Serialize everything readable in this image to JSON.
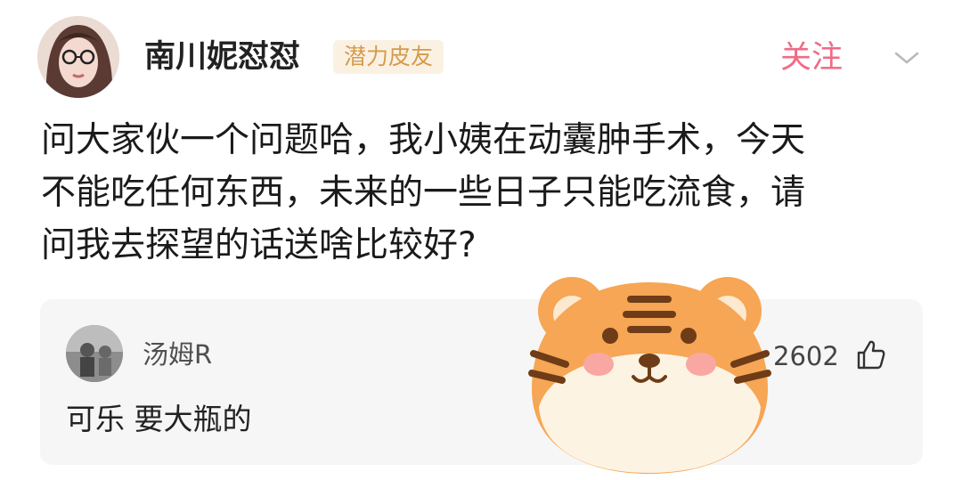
{
  "post": {
    "author": "南川妮怼怼",
    "badge": "潜力皮友",
    "follow_label": "关注",
    "lines": [
      "问大家伙一个问题哈，我小姨在动囊肿手术，今天",
      "不能吃任何东西，未来的一些日子只能吃流食，请",
      "问我去探望的话送啥比较好?"
    ]
  },
  "comment": {
    "author": "汤姆R",
    "text": "可乐 要大瓶的",
    "likes": "2602"
  },
  "colors": {
    "accent": "#f06b86",
    "badge_bg": "#fbf1e3",
    "badge_text": "#d59b4a",
    "card_bg": "#f6f6f6",
    "tiger_orange": "#f6a654"
  },
  "icons": [
    "chevron-down-icon",
    "thumb-up-icon",
    "tiger-sticker"
  ]
}
